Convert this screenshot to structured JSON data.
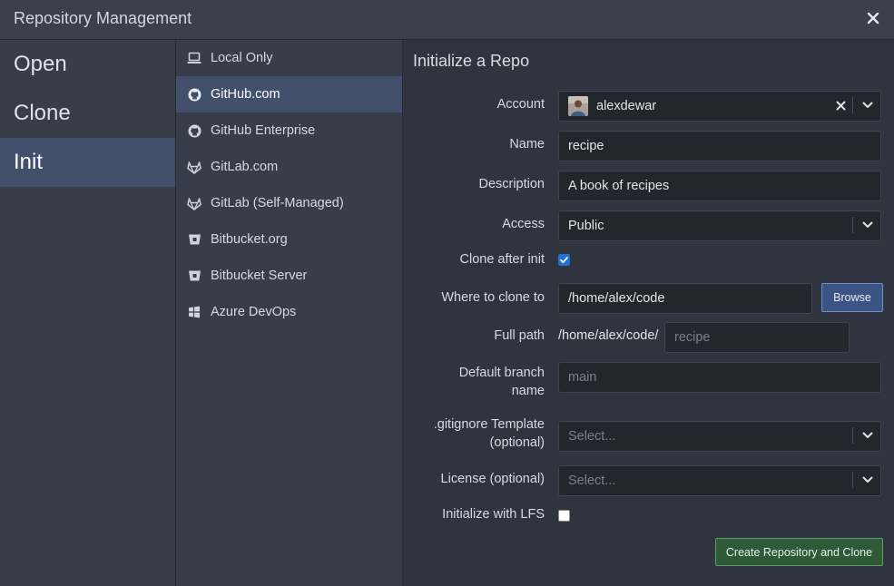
{
  "window": {
    "title": "Repository Management"
  },
  "modes": [
    {
      "label": "Open",
      "active": false
    },
    {
      "label": "Clone",
      "active": false
    },
    {
      "label": "Init",
      "active": true
    }
  ],
  "providers": [
    {
      "label": "Local Only",
      "icon": "laptop-icon",
      "active": false
    },
    {
      "label": "GitHub.com",
      "icon": "github-icon",
      "active": true
    },
    {
      "label": "GitHub Enterprise",
      "icon": "github-icon",
      "active": false
    },
    {
      "label": "GitLab.com",
      "icon": "gitlab-icon",
      "active": false
    },
    {
      "label": "GitLab (Self-Managed)",
      "icon": "gitlab-icon",
      "active": false
    },
    {
      "label": "Bitbucket.org",
      "icon": "bitbucket-icon",
      "active": false
    },
    {
      "label": "Bitbucket Server",
      "icon": "bitbucket-icon",
      "active": false
    },
    {
      "label": "Azure DevOps",
      "icon": "windows-icon",
      "active": false
    }
  ],
  "form": {
    "heading": "Initialize a Repo",
    "account": {
      "label": "Account",
      "value": "alexdewar"
    },
    "name": {
      "label": "Name",
      "value": "recipe"
    },
    "description": {
      "label": "Description",
      "value": "A book of recipes"
    },
    "access": {
      "label": "Access",
      "value": "Public"
    },
    "clone_after_init": {
      "label": "Clone after init",
      "checked": true
    },
    "clone_dir": {
      "label": "Where to clone to",
      "value": "/home/alex/code",
      "browse_label": "Browse"
    },
    "full_path": {
      "label": "Full path",
      "prefix": "/home/alex/code/",
      "placeholder": "recipe"
    },
    "default_branch": {
      "label_line1": "Default branch",
      "label_line2": "name",
      "placeholder": "main"
    },
    "gitignore": {
      "label_line1": ".gitignore Template",
      "label_line2": "(optional)",
      "placeholder": "Select..."
    },
    "license": {
      "label": "License (optional)",
      "placeholder": "Select..."
    },
    "lfs": {
      "label": "Initialize with LFS",
      "checked": false
    },
    "submit_label": "Create Repository and Clone"
  },
  "colors": {
    "active_item": "#43506c",
    "checkbox_on": "#1f6fd6",
    "browse_button": "#3a5585",
    "create_button": "#2f5a38"
  }
}
